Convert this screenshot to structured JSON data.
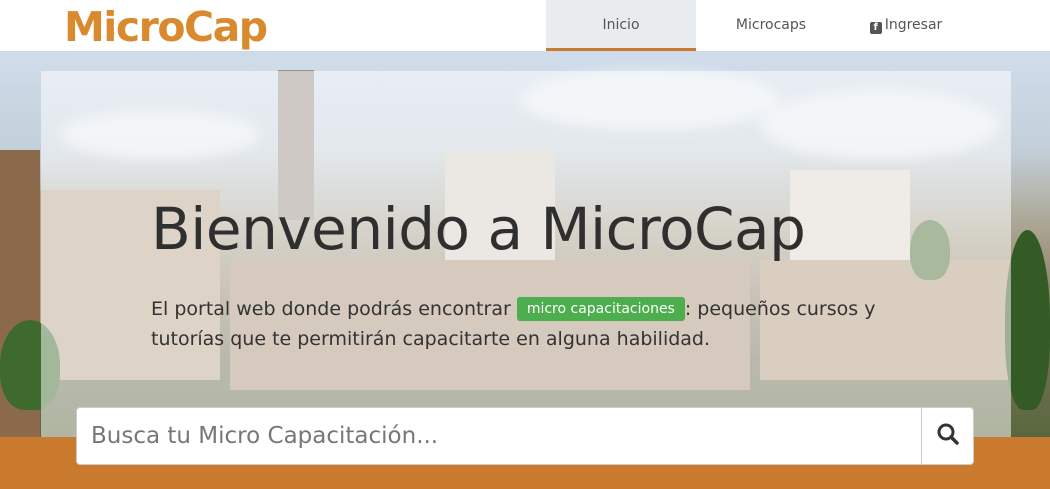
{
  "header": {
    "logo": "MicroCap",
    "nav": [
      {
        "label": "Inicio",
        "active": true
      },
      {
        "label": "Microcaps",
        "active": false
      },
      {
        "label": "Ingresar",
        "active": false,
        "icon": "facebook-icon"
      }
    ]
  },
  "hero": {
    "title": "Bienvenido a MicroCap",
    "text_before": "El portal web donde podrás encontrar",
    "badge": "micro capacitaciones",
    "text_after": ": pequeños cursos y tutorías que te permitirán capacitarte en alguna habilidad."
  },
  "search": {
    "placeholder": "Busca tu Micro Capacitación...",
    "value": "",
    "button_icon": "search-icon"
  },
  "colors": {
    "brand": "#d98a2e",
    "accent": "#c97a2c",
    "badge": "#4cae4c"
  }
}
